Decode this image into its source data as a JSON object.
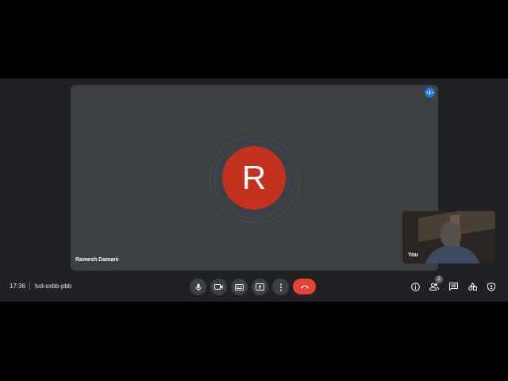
{
  "main_tile": {
    "avatar_letter": "R",
    "participant_name": "Ramesh Damani",
    "avatar_color": "#c5311f"
  },
  "self_tile": {
    "label": "You"
  },
  "footer": {
    "time": "17:36",
    "meeting_code": "tvd-sxbb-pbb",
    "people_count": "2"
  },
  "controls": {
    "center": [
      "microphone-icon",
      "camera-icon",
      "captions-icon",
      "present-icon",
      "more-options-icon",
      "end-call-icon"
    ],
    "right": [
      "info-icon",
      "people-icon",
      "chat-icon",
      "activities-icon",
      "host-controls-icon"
    ]
  },
  "colors": {
    "end_call": "#ea4335",
    "speaking": "#1a73e8",
    "background": "#202124",
    "tile": "#3c4043"
  }
}
